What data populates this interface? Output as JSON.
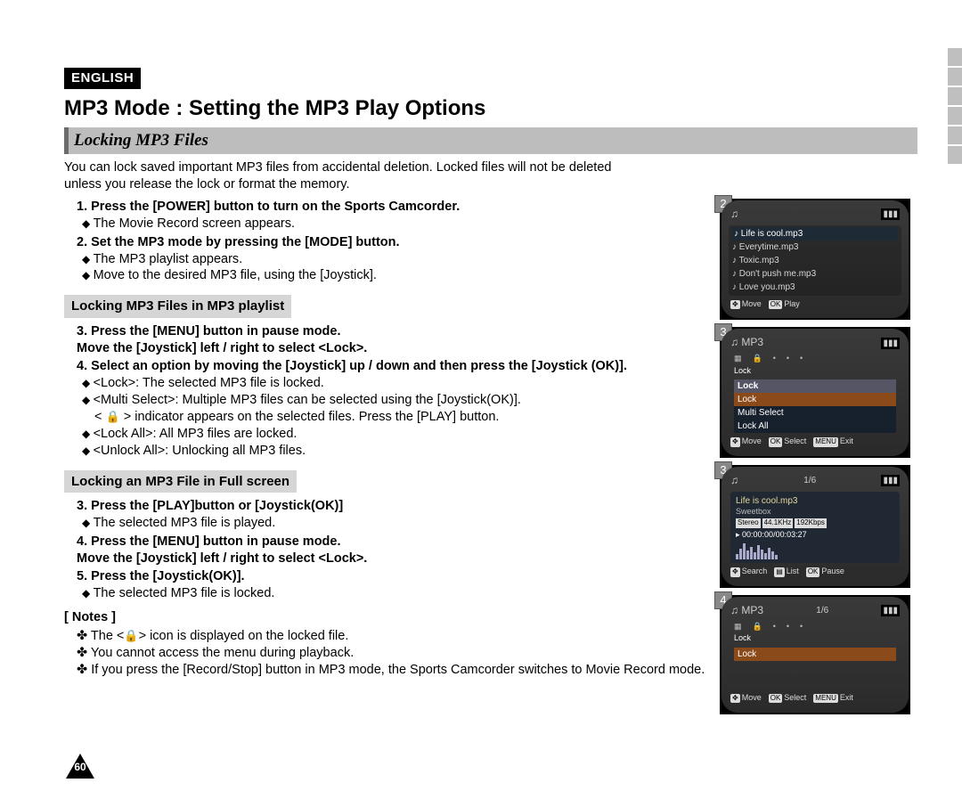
{
  "lang": "ENGLISH",
  "title": "MP3 Mode : Setting the MP3 Play Options",
  "subtitle": "Locking MP3 Files",
  "intro1": "You can lock saved important MP3 files from accidental deletion. Locked files will not be deleted",
  "intro2": "unless you release the lock or format the memory.",
  "step1": "Press the [POWER] button to turn on the Sports Camcorder.",
  "step1a": "The Movie Record screen appears.",
  "step2": "Set the MP3 mode by pressing the [MODE] button.",
  "step2a": "The MP3 playlist appears.",
  "step2b": "Move to the desired MP3 file, using the [Joystick].",
  "subheadA": "Locking MP3 Files in MP3 playlist",
  "A3a": "Press the [MENU] button in pause mode.",
  "A3b": "Move the [Joystick] left / right to select <Lock>.",
  "A4": "Select an option by moving the [Joystick] up / down and then press the [Joystick (OK)].",
  "A4_lock": "<Lock>: The selected MP3 file is locked.",
  "A4_multi": "<Multi Select>: Multiple MP3 files can be selected using the [Joystick(OK)].",
  "A4_multi_sub": "indicator appears on the selected files. Press the [PLAY] button.",
  "A4_lockall": "<Lock All>: All MP3 files are locked.",
  "A4_unlockall": "<Unlock All>: Unlocking all MP3 files.",
  "subheadB": "Locking an MP3 File in Full screen",
  "B3": "Press the [PLAY]button or [Joystick(OK)]",
  "B3a": "The selected MP3 file is played.",
  "B4a": "Press the [MENU] button in pause mode.",
  "B4b": "Move the [Joystick] left / right to select <Lock>.",
  "B5": "Press the [Joystick(OK)].",
  "B5a": "The selected MP3 file is locked.",
  "notes_title": "[ Notes ]",
  "note1a": "The <",
  "note1b": "> icon is displayed on the locked file.",
  "note2": "You cannot access the menu during playback.",
  "note3": "If you press the [Record/Stop] button in MP3 mode, the Sports Camcorder switches to Movie Record mode.",
  "page_num": "60",
  "screens": {
    "s2": {
      "badge": "2",
      "list": [
        "Life is cool.mp3",
        "Everytime.mp3",
        "Toxic.mp3",
        "Don't push me.mp3",
        "Love you.mp3"
      ],
      "bottom_move": "Move",
      "bottom_play": "Play"
    },
    "s3a": {
      "badge": "3",
      "header": "MP3",
      "tab": "Lock",
      "menu_title": "Lock",
      "items": [
        "Lock",
        "Multi Select",
        "Lock All"
      ],
      "bottom_move": "Move",
      "bottom_select": "Select",
      "bottom_exit": "Exit"
    },
    "s3b": {
      "badge": "3",
      "count": "1/6",
      "song": "Life is cool.mp3",
      "artist": "Sweetbox",
      "stereo": "Stereo",
      "khz": "44.1KHz",
      "kbps": "192Kbps",
      "time": "00:00:00/00:03:27",
      "bottom_search": "Search",
      "bottom_list": "List",
      "bottom_pause": "Pause"
    },
    "s4": {
      "badge": "4",
      "header": "MP3",
      "count": "1/6",
      "tab": "Lock",
      "item": "Lock",
      "bottom_move": "Move",
      "bottom_select": "Select",
      "bottom_exit": "Exit"
    }
  }
}
